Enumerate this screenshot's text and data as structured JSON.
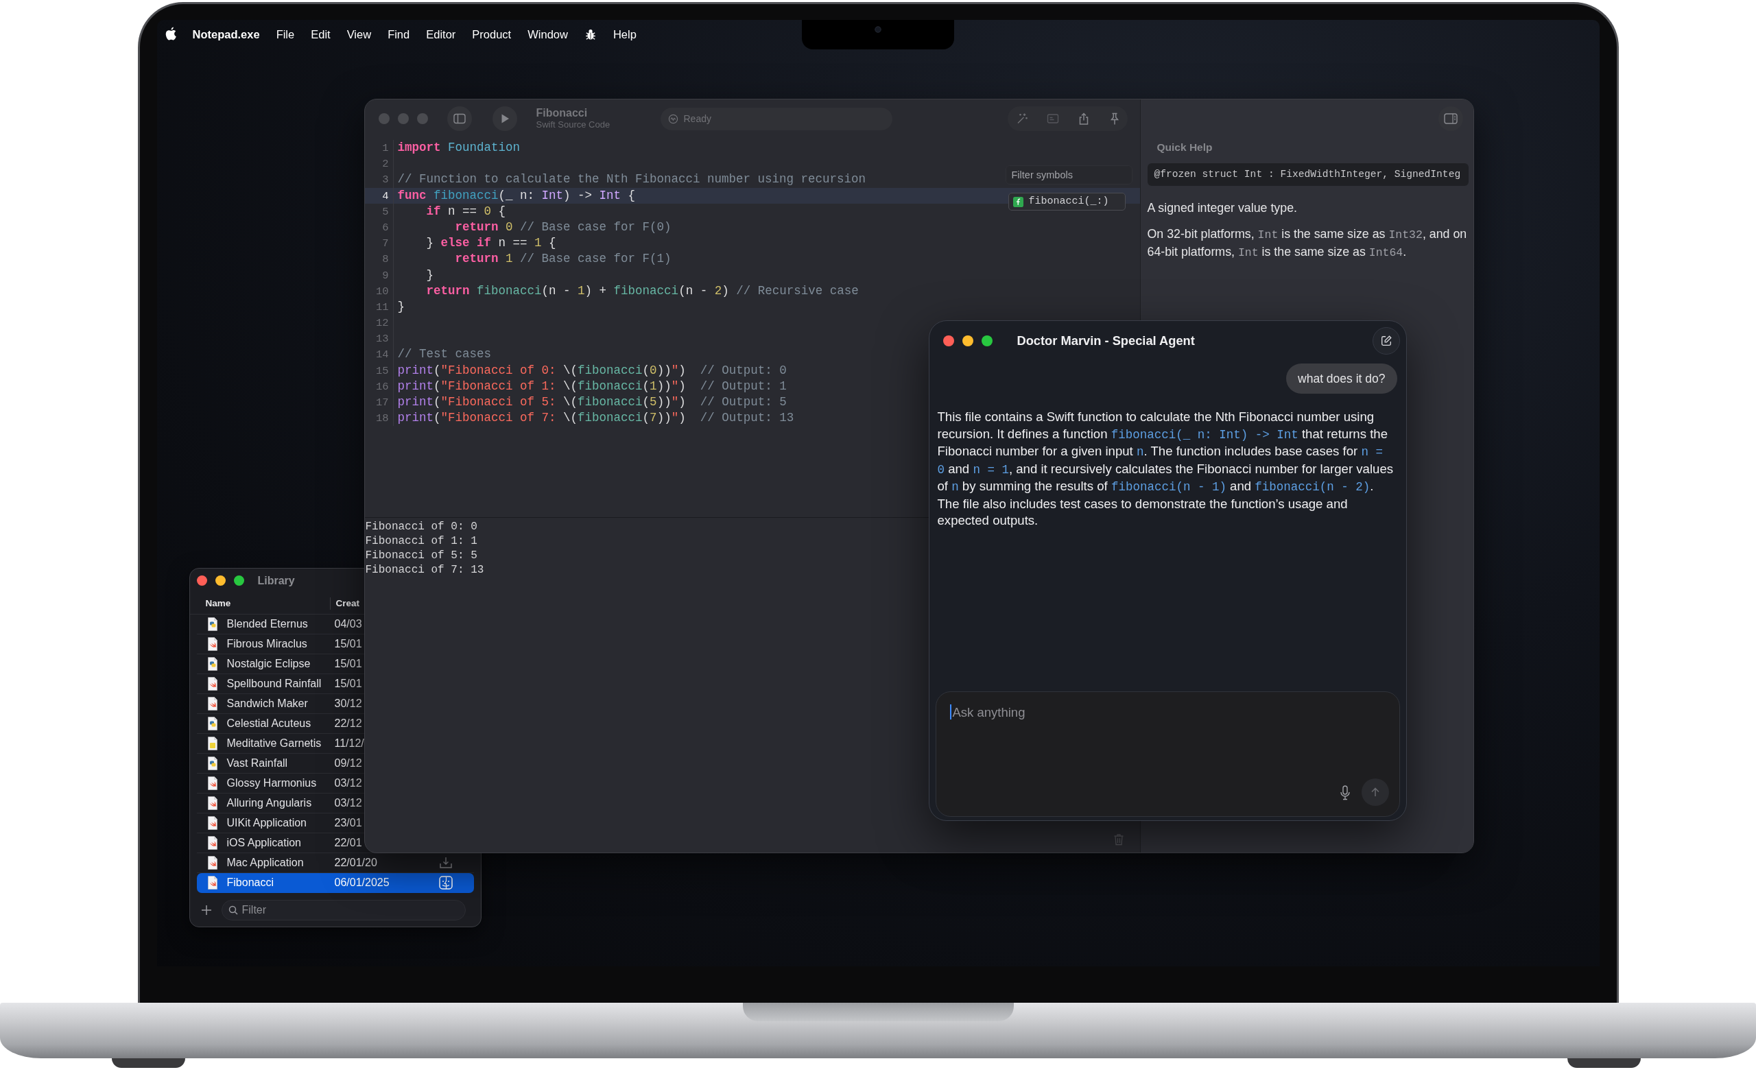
{
  "menu_bar": {
    "app_name": "Notepad.exe",
    "items": [
      {
        "kind": "text",
        "label": "File"
      },
      {
        "kind": "text",
        "label": "Edit"
      },
      {
        "kind": "text",
        "label": "View"
      },
      {
        "kind": "text",
        "label": "Find"
      },
      {
        "kind": "text",
        "label": "Editor"
      },
      {
        "kind": "text",
        "label": "Product"
      },
      {
        "kind": "text",
        "label": "Window"
      },
      {
        "kind": "icon"
      },
      {
        "kind": "text",
        "label": "Help"
      }
    ]
  },
  "library": {
    "active": true,
    "title": "Library",
    "columns": [
      "Name",
      "Creat"
    ],
    "rows": [
      {
        "name": "Blended Eternus",
        "date": "04/03",
        "kind": "python",
        "selected": false
      },
      {
        "name": "Fibrous Miraclus",
        "date": "15/01",
        "kind": "swift",
        "selected": false
      },
      {
        "name": "Nostalgic Eclipse",
        "date": "15/01",
        "kind": "python",
        "selected": false
      },
      {
        "name": "Spellbound Rainfall",
        "date": "15/01",
        "kind": "swift",
        "selected": false
      },
      {
        "name": "Sandwich Maker",
        "date": "30/12",
        "kind": "swift",
        "selected": false
      },
      {
        "name": "Celestial Acuteus",
        "date": "22/12",
        "kind": "python",
        "selected": false
      },
      {
        "name": "Meditative Garnetis",
        "date": "11/12/",
        "kind": "javascript",
        "selected": false
      },
      {
        "name": "Vast Rainfall",
        "date": "09/12",
        "kind": "python",
        "selected": false
      },
      {
        "name": "Glossy Harmonius",
        "date": "03/12",
        "kind": "swift",
        "selected": false
      },
      {
        "name": "Alluring Angularis",
        "date": "03/12",
        "kind": "swift",
        "selected": false
      },
      {
        "name": "UIKit Application",
        "date": "23/01",
        "kind": "swift",
        "selected": false
      },
      {
        "name": "iOS Application",
        "date": "22/01",
        "kind": "swift",
        "selected": false
      },
      {
        "name": "Mac Application",
        "date": "22/01/20",
        "kind": "swift",
        "selected": false,
        "trailing": {
          "kind": "download"
        }
      },
      {
        "name": "Fibonacci",
        "date": "06/01/2025",
        "kind": "swift",
        "selected": true,
        "trailing": {
          "kind": "finder"
        }
      }
    ],
    "filter": {
      "placeholder": "Filter"
    }
  },
  "editor": {
    "active": false,
    "title": "Fibonacci",
    "subtitle": "Swift Source Code",
    "status": "Ready",
    "code_lines": [
      {
        "number": "1",
        "highlighted": false,
        "tokens": [
          {
            "kind": "keyword",
            "text": "import"
          },
          {
            "kind": "module",
            "text": " Foundation"
          }
        ]
      },
      {
        "number": "2",
        "highlighted": false
      },
      {
        "number": "3",
        "highlighted": false,
        "tokens": [
          {
            "kind": "comment",
            "text": "// Function to calculate the Nth Fibonacci number using recursion"
          }
        ]
      },
      {
        "number": "4",
        "highlighted": true,
        "tokens": [
          {
            "kind": "keyword",
            "text": "func"
          },
          {
            "kind": "decl",
            "text": " fibonacci"
          },
          {
            "kind": "plain",
            "text": "(_ n: "
          },
          {
            "kind": "type",
            "text": "Int"
          },
          {
            "kind": "plain",
            "text": ") -> "
          },
          {
            "kind": "type",
            "text": "Int"
          },
          {
            "kind": "plain",
            "text": " {"
          }
        ]
      },
      {
        "number": "5",
        "highlighted": false,
        "tokens": [
          {
            "kind": "keyword",
            "text": "    if"
          },
          {
            "kind": "plain",
            "text": " n == "
          },
          {
            "kind": "number",
            "text": "0"
          },
          {
            "kind": "plain",
            "text": " {"
          }
        ]
      },
      {
        "number": "6",
        "highlighted": false,
        "tokens": [
          {
            "kind": "keyword",
            "text": "        return"
          },
          {
            "kind": "number",
            "text": " 0"
          },
          {
            "kind": "comment",
            "text": " // Base case for F(0)"
          }
        ]
      },
      {
        "number": "7",
        "highlighted": false,
        "tokens": [
          {
            "kind": "plain",
            "text": "    } "
          },
          {
            "kind": "keyword",
            "text": "else"
          },
          {
            "kind": "keyword",
            "text": " if"
          },
          {
            "kind": "plain",
            "text": " n == "
          },
          {
            "kind": "number",
            "text": "1"
          },
          {
            "kind": "plain",
            "text": " {"
          }
        ]
      },
      {
        "number": "8",
        "highlighted": false,
        "tokens": [
          {
            "kind": "keyword",
            "text": "        return"
          },
          {
            "kind": "number",
            "text": " 1"
          },
          {
            "kind": "comment",
            "text": " // Base case for F(1)"
          }
        ]
      },
      {
        "number": "9",
        "highlighted": false,
        "tokens": [
          {
            "kind": "plain",
            "text": "    }"
          }
        ]
      },
      {
        "number": "10",
        "highlighted": false,
        "tokens": [
          {
            "kind": "keyword",
            "text": "    return"
          },
          {
            "kind": "call",
            "text": " fibonacci"
          },
          {
            "kind": "plain",
            "text": "(n - "
          },
          {
            "kind": "number",
            "text": "1"
          },
          {
            "kind": "plain",
            "text": ") + "
          },
          {
            "kind": "call",
            "text": "fibonacci"
          },
          {
            "kind": "plain",
            "text": "(n - "
          },
          {
            "kind": "number",
            "text": "2"
          },
          {
            "kind": "plain",
            "text": ") "
          },
          {
            "kind": "comment",
            "text": "// Recursive case"
          }
        ]
      },
      {
        "number": "11",
        "highlighted": false,
        "tokens": [
          {
            "kind": "plain",
            "text": "}"
          }
        ]
      },
      {
        "number": "12",
        "highlighted": false
      },
      {
        "number": "13",
        "highlighted": false
      },
      {
        "number": "14",
        "highlighted": false,
        "tokens": [
          {
            "kind": "comment",
            "text": "// Test cases"
          }
        ]
      },
      {
        "number": "15",
        "highlighted": false,
        "tokens": [
          {
            "kind": "builtin",
            "text": "print"
          },
          {
            "kind": "plain",
            "text": "("
          },
          {
            "kind": "string",
            "text": "\"Fibonacci of 0: "
          },
          {
            "kind": "plain",
            "text": "\\("
          },
          {
            "kind": "call",
            "text": "fibonacci"
          },
          {
            "kind": "plain",
            "text": "("
          },
          {
            "kind": "number",
            "text": "0"
          },
          {
            "kind": "plain",
            "text": "))"
          },
          {
            "kind": "string",
            "text": "\""
          },
          {
            "kind": "plain",
            "text": ")  "
          },
          {
            "kind": "comment",
            "text": "// Output: 0"
          }
        ]
      },
      {
        "number": "16",
        "highlighted": false,
        "tokens": [
          {
            "kind": "builtin",
            "text": "print"
          },
          {
            "kind": "plain",
            "text": "("
          },
          {
            "kind": "string",
            "text": "\"Fibonacci of 1: "
          },
          {
            "kind": "plain",
            "text": "\\("
          },
          {
            "kind": "call",
            "text": "fibonacci"
          },
          {
            "kind": "plain",
            "text": "("
          },
          {
            "kind": "number",
            "text": "1"
          },
          {
            "kind": "plain",
            "text": "))"
          },
          {
            "kind": "string",
            "text": "\""
          },
          {
            "kind": "plain",
            "text": ")  "
          },
          {
            "kind": "comment",
            "text": "// Output: 1"
          }
        ]
      },
      {
        "number": "17",
        "highlighted": false,
        "tokens": [
          {
            "kind": "builtin",
            "text": "print"
          },
          {
            "kind": "plain",
            "text": "("
          },
          {
            "kind": "string",
            "text": "\"Fibonacci of 5: "
          },
          {
            "kind": "plain",
            "text": "\\("
          },
          {
            "kind": "call",
            "text": "fibonacci"
          },
          {
            "kind": "plain",
            "text": "("
          },
          {
            "kind": "number",
            "text": "5"
          },
          {
            "kind": "plain",
            "text": "))"
          },
          {
            "kind": "string",
            "text": "\""
          },
          {
            "kind": "plain",
            "text": ")  "
          },
          {
            "kind": "comment",
            "text": "// Output: 5"
          }
        ]
      },
      {
        "number": "18",
        "highlighted": false,
        "tokens": [
          {
            "kind": "builtin",
            "text": "print"
          },
          {
            "kind": "plain",
            "text": "("
          },
          {
            "kind": "string",
            "text": "\"Fibonacci of 7: "
          },
          {
            "kind": "plain",
            "text": "\\("
          },
          {
            "kind": "call",
            "text": "fibonacci"
          },
          {
            "kind": "plain",
            "text": "("
          },
          {
            "kind": "number",
            "text": "7"
          },
          {
            "kind": "plain",
            "text": "))"
          },
          {
            "kind": "string",
            "text": "\""
          },
          {
            "kind": "plain",
            "text": ")  "
          },
          {
            "kind": "comment",
            "text": "// Output: 13"
          }
        ]
      }
    ],
    "symbol_filter": {
      "placeholder": "Filter symbols",
      "symbols": [
        {
          "label": "fibonacci(_:)"
        }
      ]
    },
    "console_lines": [
      "Fibonacci of 0: 0",
      "Fibonacci of 1: 1",
      "Fibonacci of 5: 5",
      "Fibonacci of 7: 13"
    ],
    "quick_help": {
      "title": "Quick Help",
      "declaration": "@frozen struct Int : FixedWidthInteger, SignedInteg",
      "summary": "A signed integer value type.",
      "discussion": [
        {
          "kind": "text",
          "text": "On 32-bit platforms, "
        },
        {
          "kind": "code",
          "text": "Int"
        },
        {
          "kind": "text",
          "text": " is the same size as "
        },
        {
          "kind": "code",
          "text": "Int32"
        },
        {
          "kind": "text",
          "text": ", and on 64-bit platforms, "
        },
        {
          "kind": "code",
          "text": "Int"
        },
        {
          "kind": "text",
          "text": " is the same size as "
        },
        {
          "kind": "code",
          "text": "Int64"
        },
        {
          "kind": "text",
          "text": "."
        }
      ]
    }
  },
  "chat": {
    "active": true,
    "title": "Doctor Marvin - Special Agent",
    "messages": [
      {
        "kind": "user",
        "text": "what does it do?"
      },
      {
        "kind": "assistant",
        "segments": [
          {
            "kind": "text",
            "text": "This file contains a Swift function to calculate the Nth Fibonacci number using recursion. It defines a function "
          },
          {
            "kind": "code",
            "text": "fibonacci(_ n: Int) -> Int"
          },
          {
            "kind": "text",
            "text": " that returns the Fibonacci number for a given input "
          },
          {
            "kind": "code",
            "text": "n"
          },
          {
            "kind": "text",
            "text": ". The function includes base cases for "
          },
          {
            "kind": "code",
            "text": "n = 0"
          },
          {
            "kind": "text",
            "text": " and "
          },
          {
            "kind": "code",
            "text": "n = 1"
          },
          {
            "kind": "text",
            "text": ", and it recursively calculates the Fibonacci number for larger values of "
          },
          {
            "kind": "code",
            "text": "n"
          },
          {
            "kind": "text",
            "text": " by summing the results of "
          },
          {
            "kind": "code",
            "text": "fibonacci(n - 1)"
          },
          {
            "kind": "text",
            "text": " and "
          },
          {
            "kind": "code",
            "text": "fibonacci(n - 2)"
          },
          {
            "kind": "text",
            "text": ". The file also includes test cases to demonstrate the function’s usage and expected outputs."
          }
        ]
      }
    ],
    "input": {
      "placeholder": "Ask anything",
      "focused": true
    }
  }
}
